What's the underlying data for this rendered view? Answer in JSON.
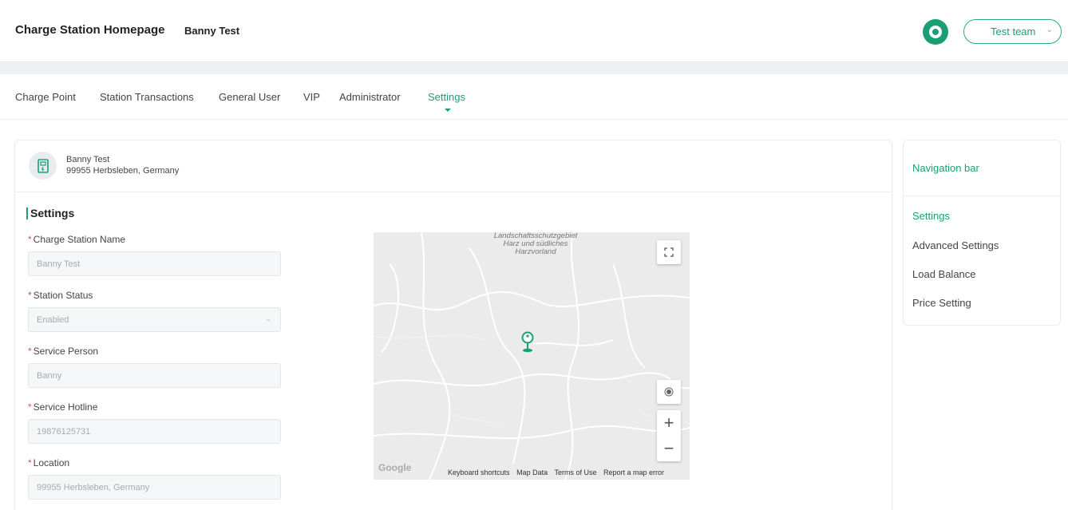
{
  "header": {
    "title": "Charge Station Homepage",
    "subtitle": "Banny Test",
    "team_select": "Test team"
  },
  "tabs": [
    {
      "label": "Charge Point"
    },
    {
      "label": "Station Transactions"
    },
    {
      "label": "General User"
    },
    {
      "label": "VIP"
    },
    {
      "label": "Administrator"
    },
    {
      "label": "Settings",
      "active": true
    }
  ],
  "station": {
    "name": "Banny Test",
    "address": "99955 Herbsleben, Germany"
  },
  "settings": {
    "section_title": "Settings",
    "fields": [
      {
        "label": "Charge Station Name",
        "value": "Banny Test"
      },
      {
        "label": "Station Status",
        "value": "Enabled"
      },
      {
        "label": "Service Person",
        "value": "Banny"
      },
      {
        "label": "Service Hotline",
        "value": "19876125731"
      },
      {
        "label": "Location",
        "value": "99955 Herbsleben, Germany"
      }
    ]
  },
  "map": {
    "region_label": "Landschaftsschutzgebiet Harz und südliches Harzvorland",
    "footer": [
      "Keyboard shortcuts",
      "Map Data",
      "Terms of Use",
      "Report a map error"
    ],
    "logo_text": "Google"
  },
  "nav": {
    "title": "Navigation bar",
    "items": [
      {
        "label": "Settings",
        "active": true
      },
      {
        "label": "Advanced Settings"
      },
      {
        "label": "Load Balance"
      },
      {
        "label": "Price Setting"
      }
    ]
  },
  "colors": {
    "accent": "#1a9f75",
    "required": "#e05050"
  }
}
